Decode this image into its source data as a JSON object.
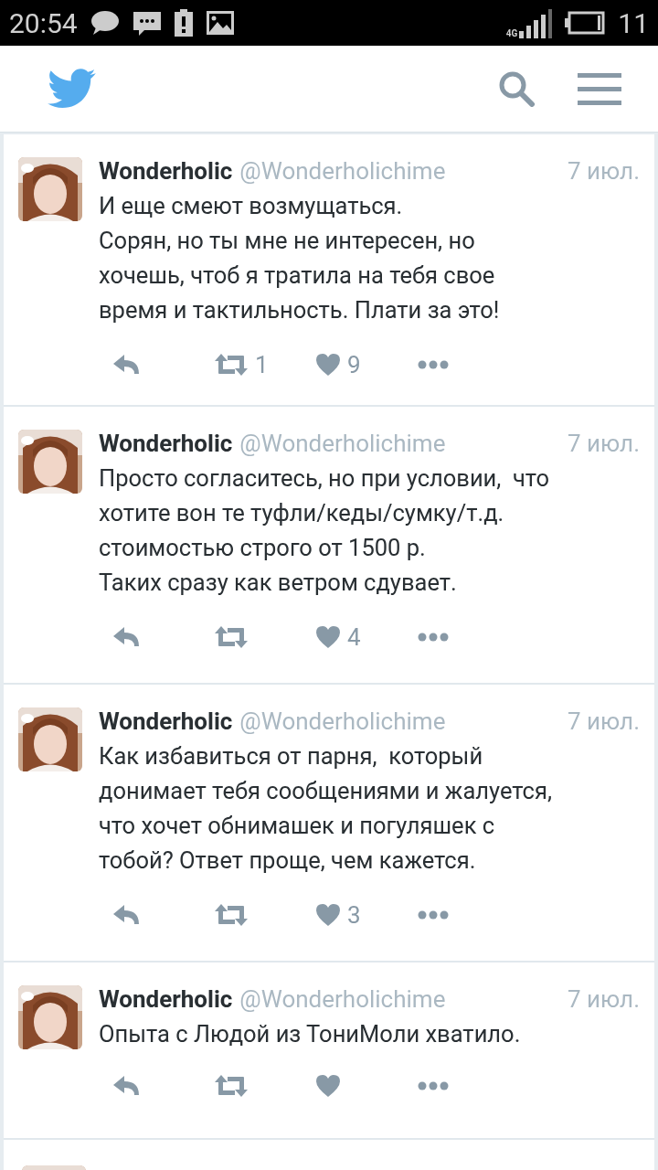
{
  "status_bar": {
    "time": "20:54",
    "network": "4G",
    "battery_level_text": "11"
  },
  "tweets": [
    {
      "name": "Wonderholic",
      "handle": "@Wonderholichime",
      "date": "7 июл.",
      "text": "И еще смеют возмущаться.\nСорян, но ты мне не интересен, но\nхочешь, чтоб я тратила на тебя свое\nвремя и тактильность. Плати за это!",
      "retweets": "1",
      "likes": "9"
    },
    {
      "name": "Wonderholic",
      "handle": "@Wonderholichime",
      "date": "7 июл.",
      "text": "Просто согласитесь, но при условии,  что\nхотите вон те туфли/кеды/сумку/т.д.\nстоимостью строго от 1500 р.\nТаких сразу как ветром сдувает.",
      "likes": "4"
    },
    {
      "name": "Wonderholic",
      "handle": "@Wonderholichime",
      "date": "7 июл.",
      "text": "Как избавиться от парня,  который\nдонимает тебя сообщениями и жалуется,\nчто хочет обнимашек и погуляшек с\nтобой? Ответ проще, чем кажется.",
      "likes": "3"
    },
    {
      "name": "Wonderholic",
      "handle": "@Wonderholichime",
      "date": "7 июл.",
      "text": "Опыта с Людой из ТониМоли хватило."
    }
  ]
}
